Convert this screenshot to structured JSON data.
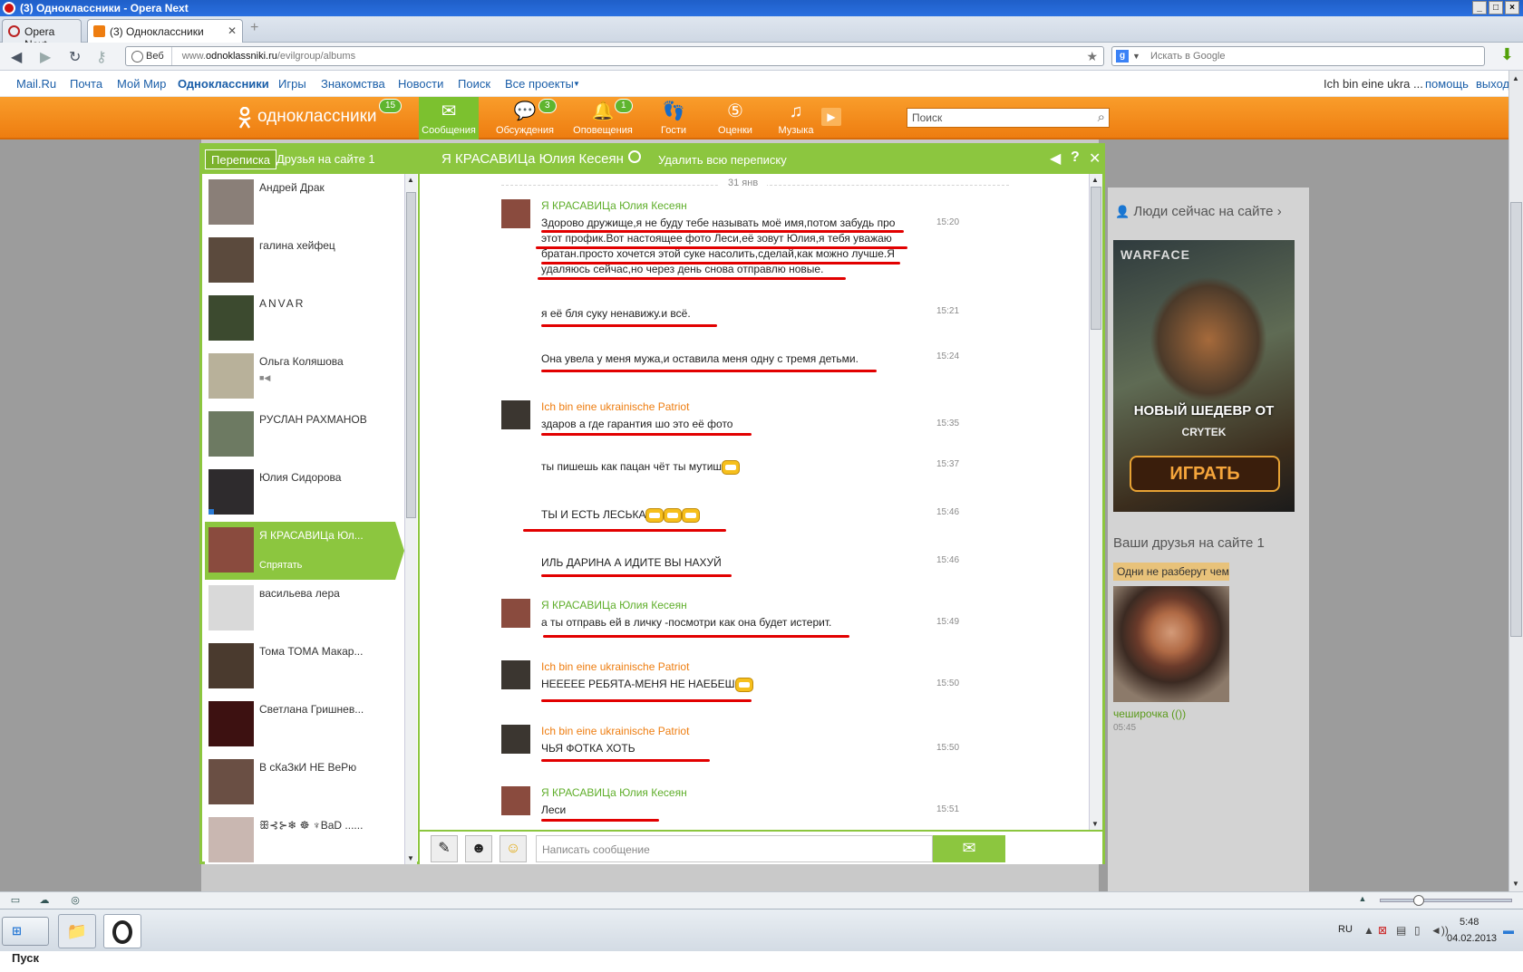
{
  "window": {
    "title": "(3) Одноклассники - Opera Next"
  },
  "tabs": [
    {
      "label": "Opera Next"
    },
    {
      "label": "(3) Одноклассники"
    }
  ],
  "address": {
    "web_label": "Веб",
    "url_prefix": "www.",
    "url_domain": "odnoklassniki.ru",
    "url_path": "/evilgroup/albums"
  },
  "search": {
    "placeholder": "Искать в Google"
  },
  "portal": {
    "links": [
      "Mail.Ru",
      "Почта",
      "Мой Мир",
      "Одноклассники",
      "Игры",
      "Знакомства",
      "Новости",
      "Поиск",
      "Все проекты"
    ],
    "user": "Ich bin eine ukra ...",
    "help": "помощь",
    "logout": "выход"
  },
  "ok": {
    "logo_text": "одноклассники",
    "logo_badge": "15",
    "nav": [
      {
        "label": "Сообщения",
        "icon": "envelope-icon",
        "badge": ""
      },
      {
        "label": "Обсуждения",
        "icon": "discussions-icon",
        "badge": "3"
      },
      {
        "label": "Оповещения",
        "icon": "bell-icon",
        "badge": "1"
      },
      {
        "label": "Гости",
        "icon": "footprints-icon",
        "badge": ""
      },
      {
        "label": "Оценки",
        "icon": "five-rating-icon",
        "badge": ""
      },
      {
        "label": "Музыка",
        "icon": "music-note-icon",
        "badge": ""
      }
    ],
    "search_placeholder": "Поиск"
  },
  "chat": {
    "tab_conversations": "Переписка",
    "tab_friends_online": "Друзья на сайте 1",
    "partner_title": "Я КРАСАВИЦа Юлия Кесеян",
    "delete_all": "Удалить всю переписку",
    "date_separator": "31 янв",
    "contacts": [
      {
        "name": "Андрей Драк",
        "color": "#8a7f78"
      },
      {
        "name": "галина хейфец",
        "color": "#5b4a3d"
      },
      {
        "name": "ANVAR",
        "color": "#3c4a2f"
      },
      {
        "name": "Ольга Коляшова",
        "color": "#b8b19a"
      },
      {
        "name": "РУСЛАН РАХМАНОВ",
        "color": "#6d7a62"
      },
      {
        "name": "Юлия Сидорова",
        "color": "#2e2b2d"
      },
      {
        "name": "Я КРАСАВИЦа Юл...",
        "color": "#8a4b3e"
      },
      {
        "name": "васильева лера",
        "color": "#d9d9d9"
      },
      {
        "name": "Тома ТОМА Макар...",
        "color": "#4a3a2e"
      },
      {
        "name": "Светлана Гришнев...",
        "color": "#3d1111"
      },
      {
        "name": "В сКаЗкИ НЕ ВеРю",
        "color": "#6a4f44"
      },
      {
        "name": "ꕥ⊰⊱❄ ☸ ♆BaD ......",
        "color": "#c9b7b1"
      }
    ],
    "hide_label": "Спрятать",
    "messages": [
      {
        "author": "Я КРАСАВИЦа Юлия Кесеян",
        "side": "green",
        "text": "Здорово дружище,я не буду тебе называть моё имя,потом забудь про этот профик.Вот настоящее фото Леси,её зовут Юлия,я тебя уважаю братан.просто хочется этой суке насолить,сделай,как можно лучше.Я удаляюсь сейчас,но через день снова отправлю новые.",
        "time": "15:20"
      },
      {
        "author": "",
        "side": "green",
        "text": "я её бля суку ненавижу.и всё.",
        "time": "15:21"
      },
      {
        "author": "",
        "side": "green",
        "text": "Она увела у меня мужа,и оставила меня одну с тремя детьми.",
        "time": "15:24"
      },
      {
        "author": "Ich bin eine ukrainische Patriot",
        "side": "orange",
        "text": "здаров а где гарантия шо это её фото",
        "time": "15:35"
      },
      {
        "author": "",
        "side": "orange",
        "text": "ты пишешь как пацан чёт ты мутиш",
        "time": "15:37"
      },
      {
        "author": "",
        "side": "orange",
        "text": "ТЫ И ЕСТЬ ЛЕСЬКА",
        "time": "15:46"
      },
      {
        "author": "",
        "side": "orange",
        "text": "ИЛЬ ДАРИНА А ИДИТЕ ВЫ НАХУЙ",
        "time": "15:46"
      },
      {
        "author": "Я КРАСАВИЦа Юлия Кесеян",
        "side": "green",
        "text": "а ты отправь ей в личку -посмотри как она будет истерит.",
        "time": "15:49"
      },
      {
        "author": "Ich bin eine ukrainische Patriot",
        "side": "orange",
        "text": "НЕЕЕЕЕ РЕБЯТА-МЕНЯ НЕ НАЕБЕШ",
        "time": "15:50"
      },
      {
        "author": "Ich bin eine ukrainische Patriot",
        "side": "orange",
        "text": "ЧЬЯ ФОТКА ХОТЬ",
        "time": "15:50"
      },
      {
        "author": "Я КРАСАВИЦа Юлия Кесеян",
        "side": "green",
        "text": "Леси",
        "time": "15:51"
      }
    ],
    "composer_placeholder": "Написать сообщение"
  },
  "sidebar": {
    "people_online": "Люди сейчас на сайте ›",
    "ad": {
      "brand": "WARFACE",
      "slogan": "НОВЫЙ ШЕДЕВР ОТ",
      "vendor": "CRYTEK",
      "cta": "ИГРАТЬ"
    },
    "friends_online": "Ваши друзья на сайте 1",
    "friend_status": "Одни не разберут чем",
    "friend_name": "чеширочка (())",
    "friend_time": "05:45"
  },
  "taskbar": {
    "start": "Пуск",
    "lang": "RU",
    "time": "5:48",
    "date": "04.02.2013"
  },
  "colors": {
    "ok_orange": "#ee7d10",
    "ok_green": "#8cc63f",
    "red_underline": "#e20000"
  }
}
